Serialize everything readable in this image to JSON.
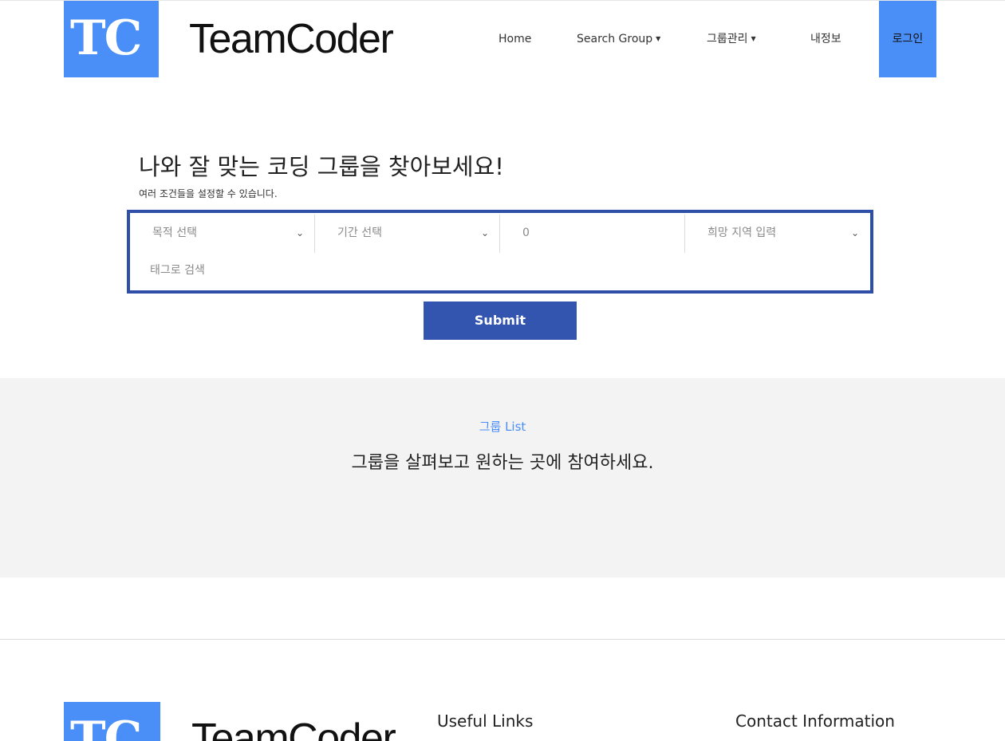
{
  "header": {
    "logo_mark": "TC",
    "logo_text": "TeamCoder",
    "nav": {
      "home": "Home",
      "search_group": "Search Group",
      "group_manage": "그룹관리",
      "my_info": "내정보",
      "login": "로그인"
    }
  },
  "search": {
    "title": "나와 잘 맞는 코딩 그룹을 찾아보세요!",
    "subtitle": "여러 조건들을 설정할 수 있습니다.",
    "purpose_select": "목적 선택",
    "period_select": "기간 선택",
    "number_value": "0",
    "region_select": "희망 지역 입력",
    "tag_placeholder": "태그로 검색",
    "submit": "Submit"
  },
  "group_list": {
    "kicker": "그룹 List",
    "title": "그룹을 살펴보고 원하는 곳에 참여하세요."
  },
  "footer": {
    "logo_mark": "TC",
    "logo_text": "TeamCoder",
    "useful_links": "Useful Links",
    "contact": "Contact Information"
  },
  "colors": {
    "brand_blue": "#4a8ef7",
    "filter_border": "#2f4ea8",
    "submit_bg": "#3355b0",
    "section_grey": "#f3f3f3"
  }
}
